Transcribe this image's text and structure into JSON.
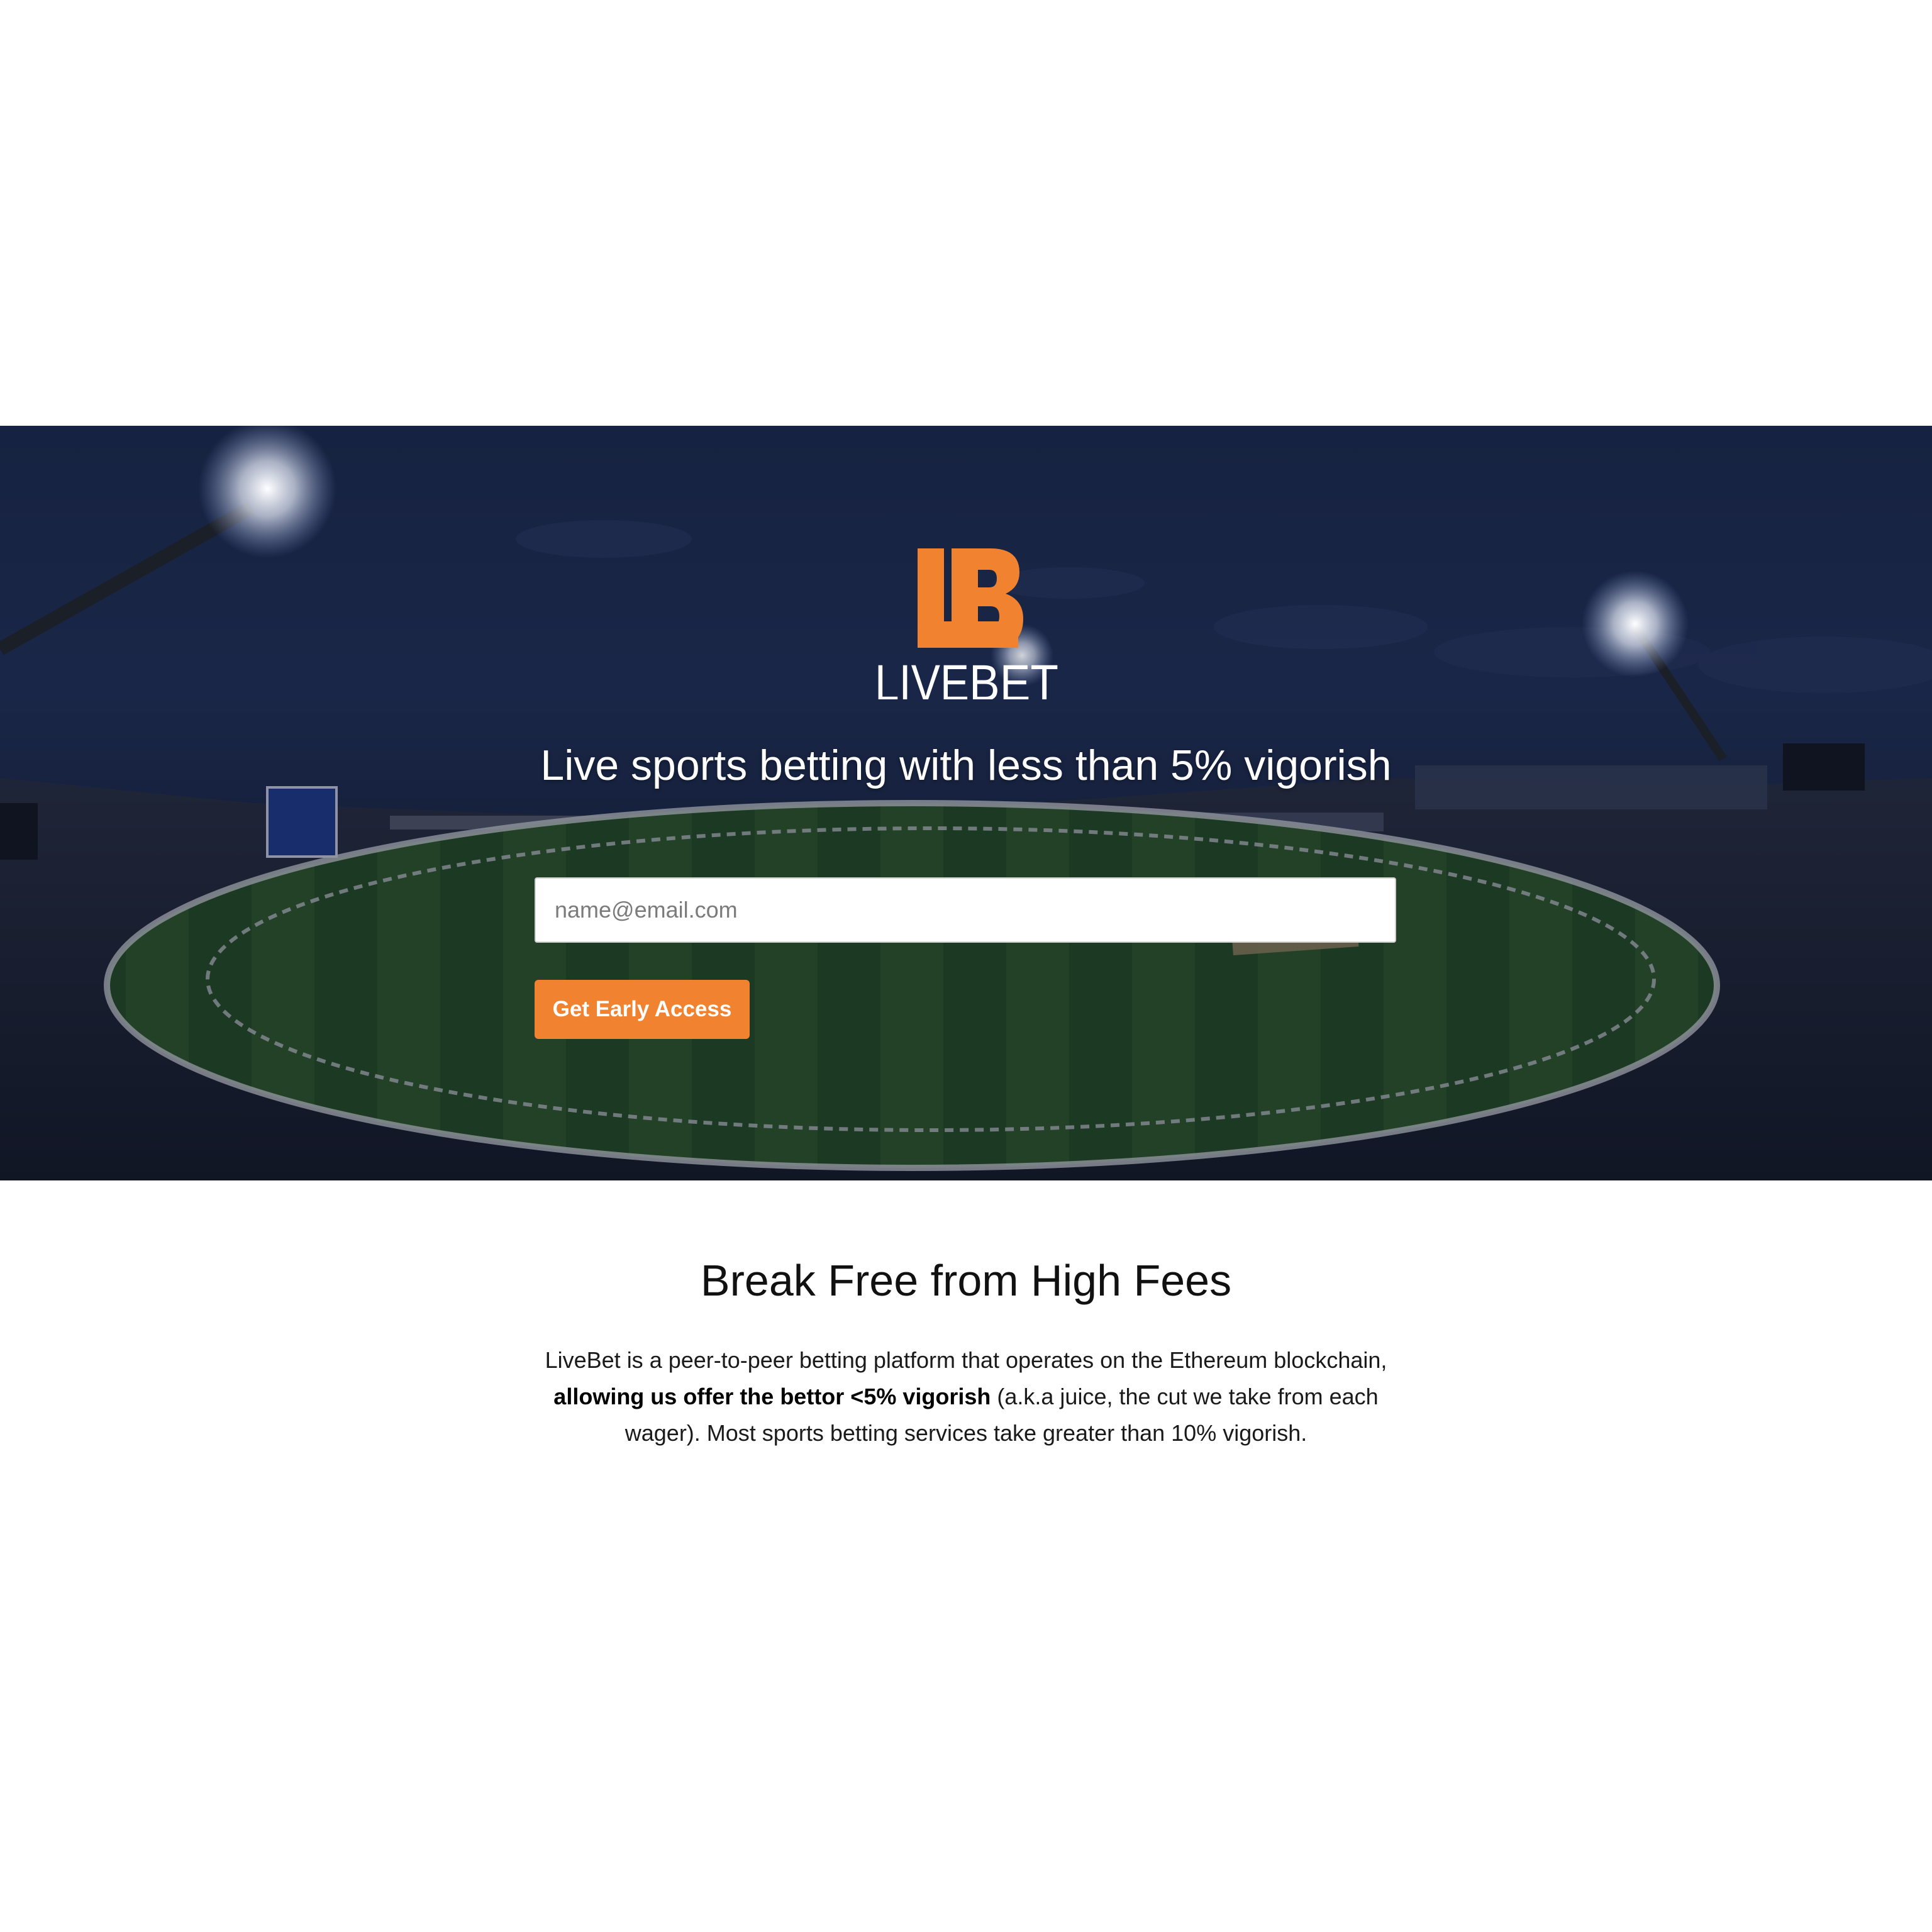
{
  "brand": {
    "logo_mark": "LB",
    "logo_wordmark_light": "LIVE",
    "logo_wordmark_bold": "BET",
    "accent_color": "#f08230"
  },
  "hero": {
    "headline": "Live sports betting with less than 5% vigorish",
    "email_placeholder": "name@email.com",
    "email_value": "",
    "cta_label": "Get Early Access",
    "background_image": "cricket-stadium-night"
  },
  "features": {
    "title": "Break Free from High Fees",
    "body_part1": "LiveBet is a peer-to-peer betting platform that operates on the Ethereum blockchain, ",
    "body_bold": "allowing us offer the bettor <5% vigorish",
    "body_part2": " (a.k.a juice, the cut we take from each wager). Most sports betting services take greater than 10% vigorish."
  }
}
